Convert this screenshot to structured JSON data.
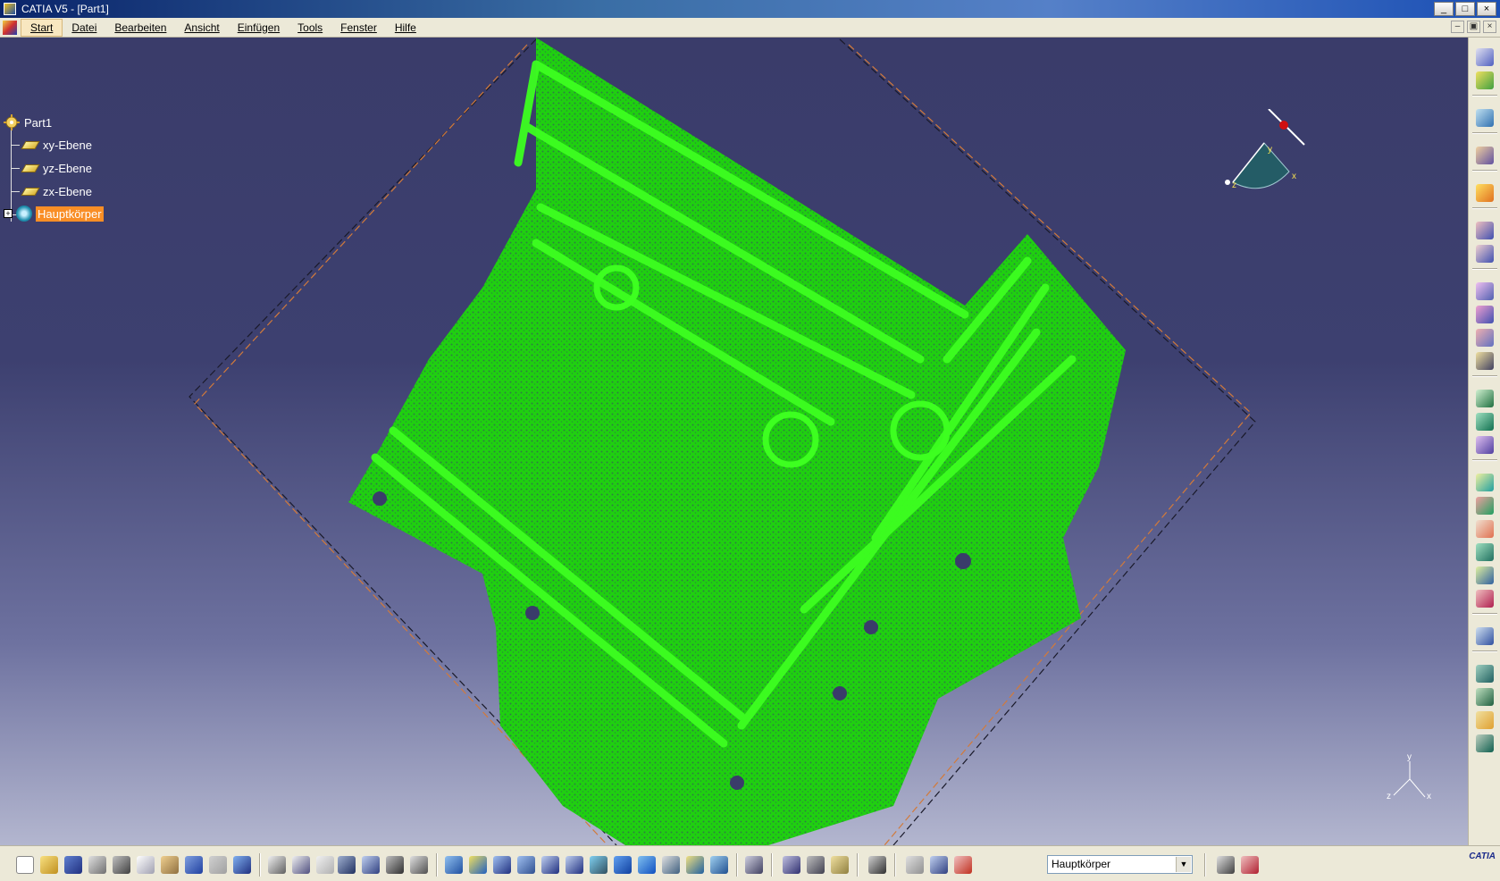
{
  "window": {
    "title": "CATIA V5 - [Part1]",
    "controls": [
      "_",
      "□",
      "×"
    ]
  },
  "menu": {
    "items": [
      "Start",
      "Datei",
      "Bearbeiten",
      "Ansicht",
      "Einfügen",
      "Tools",
      "Fenster",
      "Hilfe"
    ],
    "mdi_controls": [
      "–",
      "▣",
      "×"
    ]
  },
  "tree": {
    "root": "Part1",
    "children": [
      "xy-Ebene",
      "yz-Ebene",
      "zx-Ebene"
    ],
    "body": "Hauptkörper"
  },
  "compass": {
    "x_label": "x",
    "y_label": "y",
    "z_label": "z"
  },
  "axis_triad": {
    "x_label": "x",
    "y_label": "y",
    "z_label": "z"
  },
  "bottom_toolbar": {
    "current_body": "Hauptkörper",
    "dropdown_arrow": "▼",
    "logo_text": "CATIA"
  },
  "colors": {
    "viewport_top": "#3a3c6a",
    "viewport_bottom": "#b3b6cf",
    "point_cloud": "#2eff1a",
    "selection": "#f98e26",
    "bounding_box_orange": "#d27a3a",
    "bounding_box_dark": "#1a1a2a"
  }
}
